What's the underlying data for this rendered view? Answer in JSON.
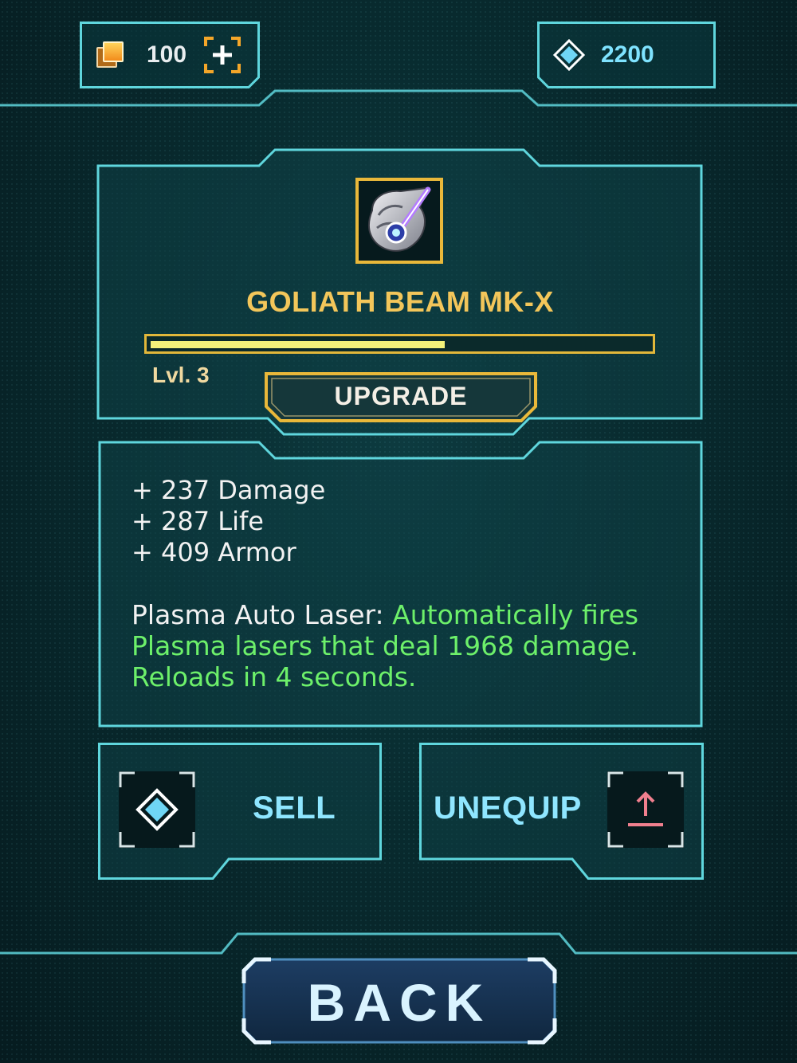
{
  "currency": {
    "coins": "100",
    "gems": "2200"
  },
  "item": {
    "name": "GOLIATH BEAM MK-X",
    "level_label": "Lvl. 3",
    "xp_progress": 0.59,
    "upgrade_label": "UPGRADE"
  },
  "stats": [
    "+ 237 Damage",
    "+ 287 Life",
    "+ 409 Armor"
  ],
  "ability": {
    "name": "Plasma Auto Laser:",
    "description": "Automatically fires Plasma lasers that deal 1968 damage. Reloads in 4 seconds."
  },
  "actions": {
    "sell_label": "SELL",
    "unequip_label": "UNEQUIP"
  },
  "back_label": "BACK",
  "colors": {
    "frame": "#5fd6dd",
    "gold": "#e9b83a",
    "ability_text": "#6df06a",
    "button_text": "#8fe6ff"
  },
  "icons": {
    "coins": "coins-icon",
    "gems": "diamond-icon",
    "add": "add-coins-icon",
    "item": "beam-weapon-icon",
    "sell": "diamond-icon",
    "unequip": "upload-arrow-icon"
  }
}
